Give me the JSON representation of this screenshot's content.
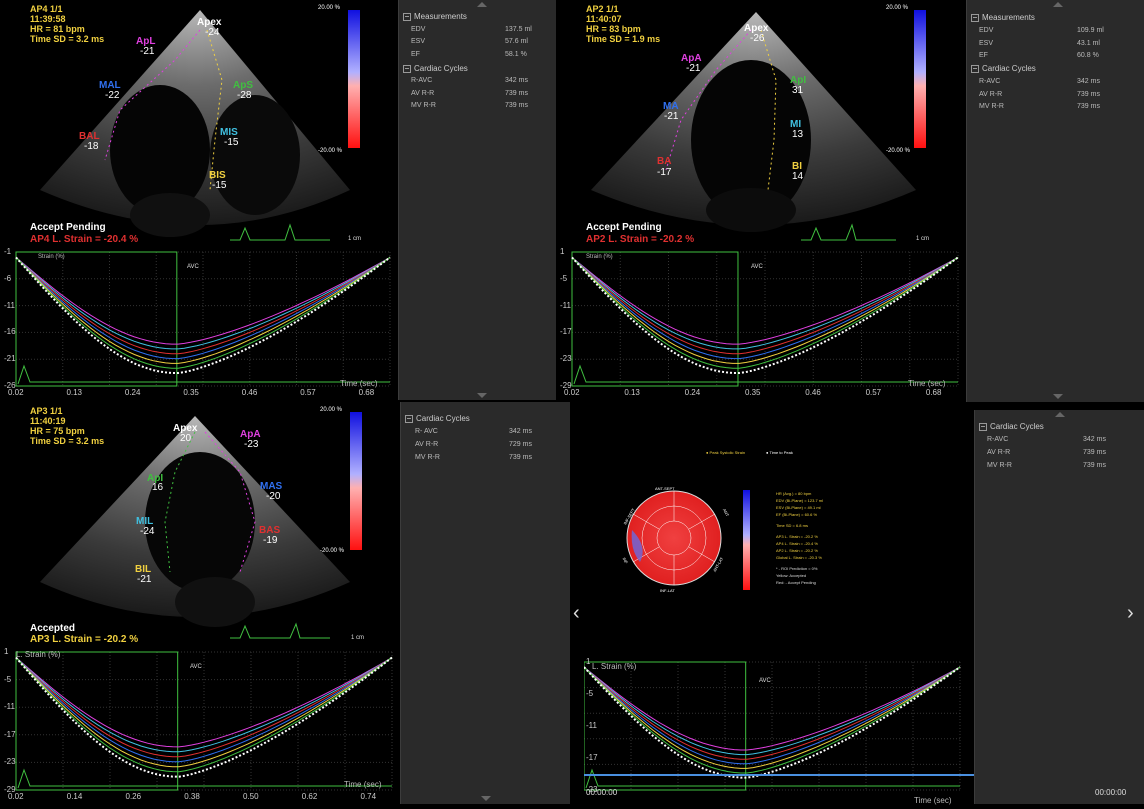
{
  "colors": {
    "apical": "#e040e0",
    "mid": "#40c0e0",
    "basal": "#e03030",
    "septal_mid": "#40c0e0",
    "ant": "#40c040",
    "yellow": "#f0d040",
    "blue": "#3070f0",
    "white": "#ffffff",
    "green_axis": "#40c040"
  },
  "panels": [
    {
      "id": "ap4",
      "view": "AP4 1/1",
      "time": "11:39:58",
      "hr": "HR = 81 bpm",
      "sd": "Time SD = 3.2 ms",
      "scale_top": "20.00 %",
      "scale_bot": "-20.00 %",
      "accept": "Accept Pending",
      "strain": "AP4 L. Strain = -20.4 %",
      "cm": "1 cm",
      "segments": [
        {
          "label": "Apex",
          "value": "-24",
          "color": "#ffffff"
        },
        {
          "label": "ApL",
          "value": "-21",
          "color": "#e040e0"
        },
        {
          "label": "ApS",
          "value": "-28",
          "color": "#40c040"
        },
        {
          "label": "MAL",
          "value": "-22",
          "color": "#3070f0"
        },
        {
          "label": "MIS",
          "value": "-15",
          "color": "#40c0e0"
        },
        {
          "label": "BAL",
          "value": "-18",
          "color": "#e03030"
        },
        {
          "label": "BIS",
          "value": "-15",
          "color": "#f0d040"
        }
      ],
      "graph": {
        "ylabel": "Strain (%)",
        "yticks": [
          "-1",
          "-6",
          "-11",
          "-16",
          "-21",
          "-26"
        ],
        "xticks": [
          "0.02",
          "0.13",
          "0.24",
          "0.35",
          "0.46",
          "0.57",
          "0.68"
        ],
        "xlabel": "Time (sec)",
        "avc": "AVC"
      },
      "sections": [
        {
          "title": "Measurements",
          "rows": [
            [
              "EDV",
              "137.5 ml"
            ],
            [
              "ESV",
              "57.6 ml"
            ],
            [
              "EF",
              "58.1 %"
            ]
          ]
        },
        {
          "title": "Cardiac Cycles",
          "rows": [
            [
              "R-AVC",
              "342 ms"
            ],
            [
              "AV R-R",
              "739 ms"
            ],
            [
              "MV R-R",
              "739 ms"
            ]
          ]
        }
      ]
    },
    {
      "id": "ap2",
      "view": "AP2 1/1",
      "time": "11:40:07",
      "hr": "HR = 83 bpm",
      "sd": "Time SD = 1.9 ms",
      "scale_top": "20.00 %",
      "scale_bot": "-20.00 %",
      "accept": "Accept Pending",
      "strain": "AP2 L. Strain = -20.2 %",
      "cm": "1 cm",
      "segments": [
        {
          "label": "Apex",
          "value": "-26",
          "color": "#ffffff"
        },
        {
          "label": "ApA",
          "value": "-21",
          "color": "#e040e0"
        },
        {
          "label": "ApI",
          "value": "31",
          "color": "#40c040"
        },
        {
          "label": "MA",
          "value": "-21",
          "color": "#3070f0"
        },
        {
          "label": "MI",
          "value": "13",
          "color": "#40c0e0"
        },
        {
          "label": "BA",
          "value": "-17",
          "color": "#e03030"
        },
        {
          "label": "BI",
          "value": "14",
          "color": "#f0d040"
        }
      ],
      "graph": {
        "ylabel": "Strain (%)",
        "yticks": [
          "1",
          "-5",
          "-11",
          "-17",
          "-23",
          "-29"
        ],
        "xticks": [
          "0.02",
          "0.13",
          "0.24",
          "0.35",
          "0.46",
          "0.57",
          "0.68"
        ],
        "xlabel": "Time (sec)",
        "avc": "AVC"
      },
      "sections": [
        {
          "title": "Measurements",
          "rows": [
            [
              "EDV",
              "109.9 ml"
            ],
            [
              "ESV",
              "43.1 ml"
            ],
            [
              "EF",
              "60.8 %"
            ]
          ]
        },
        {
          "title": "Cardiac Cycles",
          "rows": [
            [
              "R-AVC",
              "342 ms"
            ],
            [
              "AV R-R",
              "739 ms"
            ],
            [
              "MV R-R",
              "739 ms"
            ]
          ]
        }
      ]
    },
    {
      "id": "ap3",
      "view": "AP3 1/1",
      "time": "11:40:19",
      "hr": "HR = 75 bpm",
      "sd": "Time SD = 3.2 ms",
      "scale_top": "20.00 %",
      "scale_bot": "-20.00 %",
      "accept": "Accepted",
      "strain": "AP3 L. Strain = -20.2 %",
      "cm": "1 cm",
      "segments": [
        {
          "label": "Apex",
          "value": "20",
          "color": "#ffffff"
        },
        {
          "label": "ApA",
          "value": "-23",
          "color": "#e040e0"
        },
        {
          "label": "ApI",
          "value": "16",
          "color": "#40c040"
        },
        {
          "label": "MAS",
          "value": "-20",
          "color": "#3070f0"
        },
        {
          "label": "MIL",
          "value": "-24",
          "color": "#40c0e0"
        },
        {
          "label": "BAS",
          "value": "-19",
          "color": "#e03030"
        },
        {
          "label": "BIL",
          "value": "-21",
          "color": "#f0d040"
        }
      ],
      "graph": {
        "ylabel": "L. Strain (%)",
        "yticks": [
          "1",
          "-5",
          "-11",
          "-17",
          "-23",
          "-29"
        ],
        "xticks": [
          "0.02",
          "0.14",
          "0.26",
          "0.38",
          "0.50",
          "0.62",
          "0.74"
        ],
        "xlabel": "Time (sec)",
        "avc": "AVC"
      },
      "sections": [
        {
          "title": "Cardiac Cycles",
          "rows": [
            [
              "R- AVC",
              "342 ms"
            ],
            [
              "AV R-R",
              "729 ms"
            ],
            [
              "MV R-R",
              "739 ms"
            ]
          ]
        }
      ]
    }
  ],
  "summary": {
    "legend": [
      "Peak Systolic Strain",
      "Time to Peak"
    ],
    "bullseye_labels": {
      "top": "ANT-SEPT",
      "right": "ANT",
      "right_low": "ANT-LAT",
      "bottom": "INF-LAT",
      "left": "INF",
      "left_top": "INF-SEPT"
    },
    "stats": [
      "HR (Avg.) = 80 bpm",
      "EDV (Bi-Plane) = 123.7 ml",
      "ESV (Bi-Plane) = 49.1 ml",
      "EF (Bi-Plane) = 60.6 %",
      "Time SD = 6.8 ms",
      "AP3 L. Strain = -20.2 %",
      "AP4 L. Strain = -20.4 %",
      "AP2 L. Strain = -20.2 %",
      "Global L. Strain = -20.3 %",
      "* - ROI Prediction = 0%",
      "Yellow: Accepted",
      "Red: - Accept Pending"
    ],
    "graph": {
      "ylabel": "L. Strain (%)",
      "yticks": [
        "1",
        "-5",
        "-11",
        "-17",
        "-23"
      ],
      "xlabel": "Time (sec)",
      "avc": "AVC"
    },
    "time_left": "00:00:00",
    "time_right": "00:00:00",
    "sections": [
      {
        "title": "Cardiac Cycles",
        "rows": [
          [
            "R-AVC",
            "342 ms"
          ],
          [
            "AV R-R",
            "739 ms"
          ],
          [
            "MV R-R",
            "739 ms"
          ]
        ]
      }
    ]
  }
}
